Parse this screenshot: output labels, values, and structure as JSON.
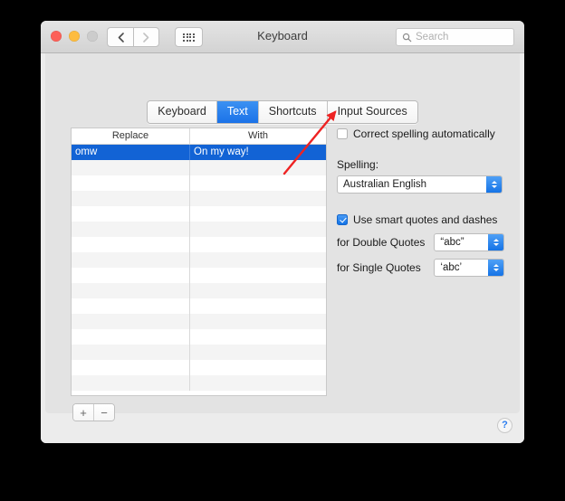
{
  "window": {
    "title": "Keyboard",
    "traffic_lights": [
      "close",
      "minimize",
      "zoom"
    ],
    "nav": {
      "back_icon": "chevron-left-icon",
      "forward_icon": "chevron-right-icon",
      "grid_icon": "show-all-grid-icon"
    },
    "search": {
      "placeholder": "Search",
      "value": "",
      "icon": "search-icon"
    }
  },
  "tabs": [
    {
      "label": "Keyboard",
      "active": false
    },
    {
      "label": "Text",
      "active": true
    },
    {
      "label": "Shortcuts",
      "active": false
    },
    {
      "label": "Input Sources",
      "active": false
    }
  ],
  "table": {
    "columns": [
      "Replace",
      "With"
    ],
    "rows": [
      {
        "replace": "omw",
        "with": "On my way!",
        "selected": true
      },
      {
        "replace": "",
        "with": "",
        "selected": false
      },
      {
        "replace": "",
        "with": "",
        "selected": false
      },
      {
        "replace": "",
        "with": "",
        "selected": false
      },
      {
        "replace": "",
        "with": "",
        "selected": false
      },
      {
        "replace": "",
        "with": "",
        "selected": false
      },
      {
        "replace": "",
        "with": "",
        "selected": false
      },
      {
        "replace": "",
        "with": "",
        "selected": false
      },
      {
        "replace": "",
        "with": "",
        "selected": false
      },
      {
        "replace": "",
        "with": "",
        "selected": false
      },
      {
        "replace": "",
        "with": "",
        "selected": false
      },
      {
        "replace": "",
        "with": "",
        "selected": false
      },
      {
        "replace": "",
        "with": "",
        "selected": false
      },
      {
        "replace": "",
        "with": "",
        "selected": false
      },
      {
        "replace": "",
        "with": "",
        "selected": false
      },
      {
        "replace": "",
        "with": "",
        "selected": false
      }
    ]
  },
  "table_buttons": {
    "add_label": "+",
    "remove_label": "−"
  },
  "options": {
    "correct_spelling": {
      "label": "Correct spelling automatically",
      "checked": false
    },
    "spelling_group_label": "Spelling:",
    "spelling_value": "Australian English",
    "smart_quotes": {
      "label": "Use smart quotes and dashes",
      "checked": true
    },
    "double_quotes_label": "for Double Quotes",
    "double_quotes_value": "“abc”",
    "single_quotes_label": "for Single Quotes",
    "single_quotes_value": "‘abc’"
  },
  "help": {
    "label": "?"
  },
  "colors": {
    "accent_blue": "#1263d5",
    "tab_active_blue": "#2680ef",
    "annotation_red": "#ee2222",
    "window_bg": "#ececec",
    "panel_bg": "#e3e3e3"
  }
}
